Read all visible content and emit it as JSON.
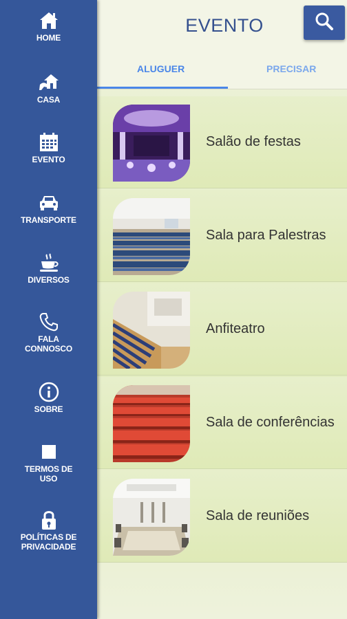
{
  "sidebar": {
    "items": [
      {
        "label": "HOME",
        "icon": "home-icon"
      },
      {
        "label": "CASA",
        "icon": "house-hand-icon"
      },
      {
        "label": "EVENTO",
        "icon": "calendar-icon"
      },
      {
        "label": "TRANSPORTE",
        "icon": "car-icon"
      },
      {
        "label": "DIVERSOS",
        "icon": "coffee-cup-icon"
      },
      {
        "label": "FALA CONNOSCO",
        "icon": "phone-icon"
      },
      {
        "label": "SOBRE",
        "icon": "info-icon"
      },
      {
        "label": "TERMOS DE USO",
        "icon": "square-icon"
      },
      {
        "label": "POLÍTICAS DE PRIVACIDADE",
        "icon": "lock-icon"
      }
    ]
  },
  "header": {
    "title": "EVENTO",
    "search_icon": "search-icon"
  },
  "tabs": [
    {
      "label": "ALUGUER",
      "active": true
    },
    {
      "label": "PRECISAR",
      "active": false
    }
  ],
  "list": {
    "items": [
      {
        "label": "Salão de festas"
      },
      {
        "label": "Sala para Palestras"
      },
      {
        "label": "Anfiteatro"
      },
      {
        "label": "Sala de conferências"
      },
      {
        "label": "Sala de reuniões"
      }
    ]
  },
  "colors": {
    "sidebar": "#35579a",
    "accent": "#4a86e8",
    "title": "#34508e",
    "list_bg": "#e3edc0"
  }
}
